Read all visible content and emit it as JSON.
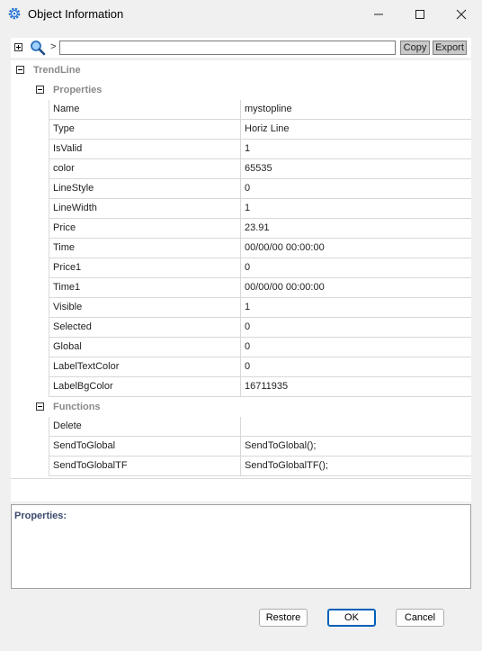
{
  "window": {
    "title": "Object Information",
    "icon": "gear-icon"
  },
  "window_controls": {
    "minimize": "—",
    "maximize": "☐",
    "close": "✕"
  },
  "toolbar": {
    "arrow": ">",
    "filter_value": "",
    "copy_label": "Copy",
    "export_label": "Export"
  },
  "tree": {
    "root_label": "TrendLine",
    "properties_label": "Properties",
    "functions_label": "Functions",
    "properties": [
      {
        "name": "Name",
        "value": "mystopline"
      },
      {
        "name": "Type",
        "value": "Horiz Line"
      },
      {
        "name": "IsValid",
        "value": "1"
      },
      {
        "name": "color",
        "value": "65535"
      },
      {
        "name": "LineStyle",
        "value": "0"
      },
      {
        "name": "LineWidth",
        "value": "1"
      },
      {
        "name": "Price",
        "value": "23.91"
      },
      {
        "name": "Time",
        "value": "00/00/00 00:00:00"
      },
      {
        "name": "Price1",
        "value": "0"
      },
      {
        "name": "Time1",
        "value": "00/00/00 00:00:00"
      },
      {
        "name": "Visible",
        "value": "1"
      },
      {
        "name": "Selected",
        "value": "0"
      },
      {
        "name": "Global",
        "value": "0"
      },
      {
        "name": "LabelTextColor",
        "value": "0"
      },
      {
        "name": "LabelBgColor",
        "value": "16711935"
      }
    ],
    "functions": [
      {
        "name": "Delete",
        "value": ""
      },
      {
        "name": "SendToGlobal",
        "value": "SendToGlobal();"
      },
      {
        "name": "SendToGlobalTF",
        "value": "SendToGlobalTF();"
      }
    ]
  },
  "description": {
    "label": "Properties:"
  },
  "buttons": {
    "restore": "Restore",
    "ok": "OK",
    "cancel": "Cancel"
  },
  "colors": {
    "group_label": "#8a8a8a",
    "desc_label": "#3c4a6e",
    "ok_border": "#005fb8"
  }
}
